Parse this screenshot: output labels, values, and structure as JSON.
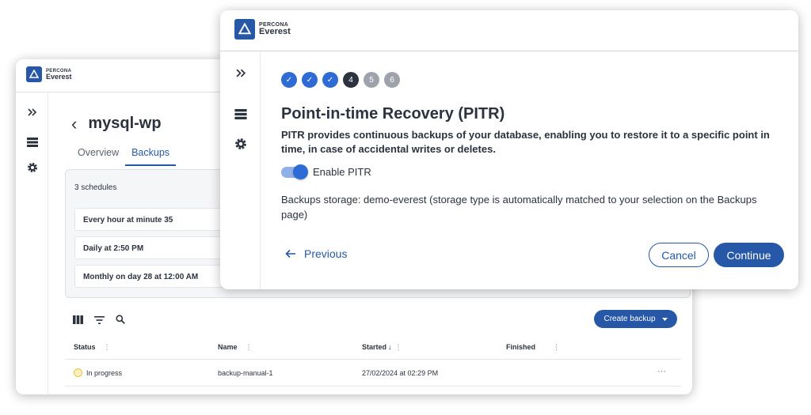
{
  "brand": {
    "line1": "PERCONA",
    "line2": "Everest"
  },
  "back_window": {
    "db_title": "mysql-wp",
    "back_glyph": "‹",
    "tabs": [
      {
        "label": "Overview",
        "active": false
      },
      {
        "label": "Backups",
        "active": true
      }
    ],
    "schedules": {
      "count_label": "3 schedules",
      "items": [
        "Every hour at minute 35",
        "Daily at 2:50 PM",
        "Monthly on day 28 at 12:00 AM"
      ]
    },
    "toolbar": {
      "create_label": "Create backup"
    },
    "table": {
      "columns": [
        "Status",
        "Name",
        "Started",
        "Finished"
      ],
      "rows": [
        {
          "status": "In progress",
          "name": "backup-manual-1",
          "started": "27/02/2024 at 02:29 PM",
          "finished": "",
          "menu": "···"
        }
      ]
    },
    "icons": [
      "expand-icon",
      "database-icon",
      "gear-icon",
      "columns-icon",
      "filter-icon",
      "search-icon"
    ]
  },
  "wizard": {
    "steps": [
      {
        "label": "✓",
        "state": "done"
      },
      {
        "label": "✓",
        "state": "done"
      },
      {
        "label": "✓",
        "state": "done"
      },
      {
        "label": "4",
        "state": "current"
      },
      {
        "label": "5",
        "state": "todo"
      },
      {
        "label": "6",
        "state": "todo"
      }
    ],
    "title": "Point-in-time Recovery (PITR)",
    "description": "PITR provides continuous backups of your database, enabling you to restore it to a specific point in time, in case of accidental writes or deletes.",
    "toggle_label": "Enable PITR",
    "toggle_on": true,
    "storage_text": "Backups storage: demo-everest (storage type is automatically matched to your selection on the Backups page)",
    "previous_label": "Previous",
    "cancel_label": "Cancel",
    "continue_label": "Continue"
  },
  "colors": {
    "primary": "#2757a7",
    "step_done": "#2e6bd4",
    "step_current": "#2c323e",
    "step_todo": "#9ea3ab"
  }
}
